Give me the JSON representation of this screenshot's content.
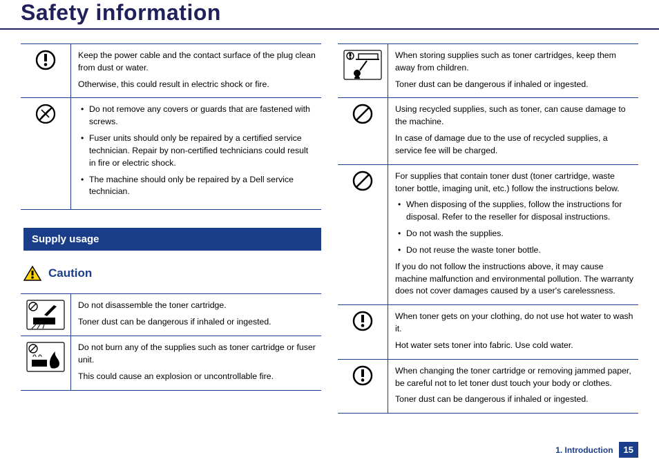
{
  "page": {
    "title": "Safety information"
  },
  "left": {
    "r1": {
      "p1": "Keep the power cable and the contact surface of the plug clean from dust or water.",
      "p2": "Otherwise, this could result in electric shock or fire."
    },
    "r2": {
      "li1": "Do not remove any covers or guards that are fastened with screws.",
      "li2": "Fuser units should only be repaired by a certified service technician. Repair by non-certified technicians could result in fire or electric shock.",
      "li3": "The machine should only be repaired by a Dell service technician."
    },
    "section_heading": "Supply usage",
    "caution_label": "Caution",
    "r3": {
      "p1": "Do not disassemble the toner cartridge.",
      "p2": "Toner dust can be dangerous if inhaled or ingested."
    },
    "r4": {
      "p1": "Do not burn any of the supplies such as toner cartridge or fuser unit.",
      "p2": "This could cause an explosion or uncontrollable fire."
    }
  },
  "right": {
    "r1": {
      "p1": "When storing supplies such as toner cartridges, keep them away from children.",
      "p2": "Toner dust can be dangerous if inhaled or ingested."
    },
    "r2": {
      "p1": "Using recycled supplies, such as toner, can cause damage to the machine.",
      "p2": "In case of damage due to the use of recycled supplies, a service fee will be charged."
    },
    "r3": {
      "p1": "For supplies that contain toner dust (toner cartridge, waste toner bottle, imaging unit, etc.) follow the instructions below.",
      "li1": "When disposing of the supplies, follow the instructions for disposal. Refer to the reseller for disposal instructions.",
      "li2": "Do not wash the supplies.",
      "li3": "Do not reuse the waste toner bottle.",
      "p2": "If you do not follow the instructions above, it may cause machine malfunction and environmental pollution. The warranty does not cover damages caused by a user's carelessness."
    },
    "r4": {
      "p1": "When toner gets on your clothing, do not use hot water to wash it.",
      "p2": "Hot water sets toner into fabric. Use cold water."
    },
    "r5": {
      "p1": "When changing the toner cartridge or removing jammed paper, be careful not to let toner dust touch your body or clothes.",
      "p2": "Toner dust can be dangerous if inhaled or ingested."
    }
  },
  "footer": {
    "chapter": "1. Introduction",
    "page_num": "15"
  }
}
